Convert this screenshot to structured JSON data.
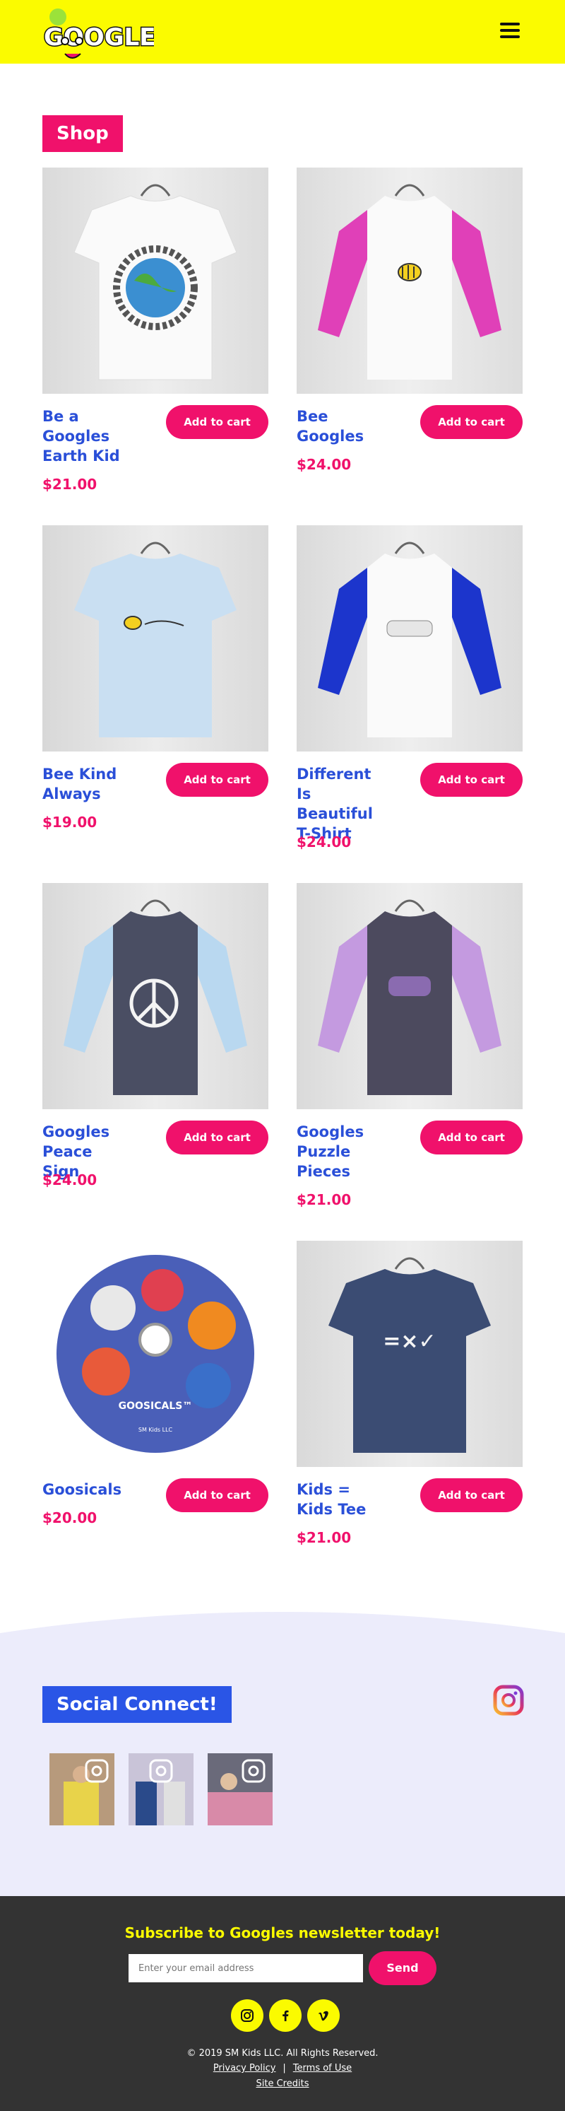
{
  "header": {
    "logo_text": "GOOGLES",
    "menu_icon": "hamburger-icon",
    "background_color": "#fbfb00"
  },
  "shop": {
    "title": "Shop",
    "accent_color": "#f0116b",
    "name_color": "#2a4fd8",
    "products": [
      {
        "name": "Be a Googles Earth Kid",
        "price": "$21.00",
        "cart_label": "Add to cart",
        "image": "white-tshirt-earth-kids"
      },
      {
        "name": "Bee Googles",
        "price": "$24.00",
        "cart_label": "Add to cart",
        "image": "pink-raglan-bee"
      },
      {
        "name": "Bee Kind Always",
        "price": "$19.00",
        "cart_label": "Add to cart",
        "image": "light-blue-tshirt-bee-kind"
      },
      {
        "name": "Different Is Beautiful T-Shirt",
        "price": "$24.00",
        "cart_label": "Add to cart",
        "image": "blue-raglan-different"
      },
      {
        "name": "Googles Peace Sign",
        "price": "$24.00",
        "cart_label": "Add to cart",
        "image": "grey-raglan-peace"
      },
      {
        "name": "Googles Puzzle Pieces",
        "price": "$21.00",
        "cart_label": "Add to cart",
        "image": "purple-raglan-puzzle"
      },
      {
        "name": "Goosicals",
        "price": "$20.00",
        "cart_label": "Add to cart",
        "image": "goosicals-cd",
        "disc_label": "GOOSICALS™",
        "disc_caption": "SM Kids LLC"
      },
      {
        "name": "Kids = Kids Tee",
        "price": "$21.00",
        "cart_label": "Add to cart",
        "image": "navy-tshirt-equals",
        "shirt_print": "=×✓"
      }
    ]
  },
  "social": {
    "title": "Social Connect!",
    "title_color": "#2a55e6",
    "instagram_icon": "instagram-icon",
    "thumbnails": [
      "instagram-post-1",
      "instagram-post-2",
      "instagram-post-3"
    ]
  },
  "footer": {
    "newsletter_title": "Subscribe to Googles newsletter today!",
    "email_placeholder": "Enter your email address",
    "send_label": "Send",
    "social_icons": [
      "instagram-icon",
      "facebook-icon",
      "vimeo-icon"
    ],
    "copyright": "© 2019 SM Kids LLC. All Rights Reserved.",
    "privacy_label": "Privacy Policy",
    "separator": "|",
    "terms_label": "Terms of Use",
    "credits_label": "Site Credits"
  }
}
